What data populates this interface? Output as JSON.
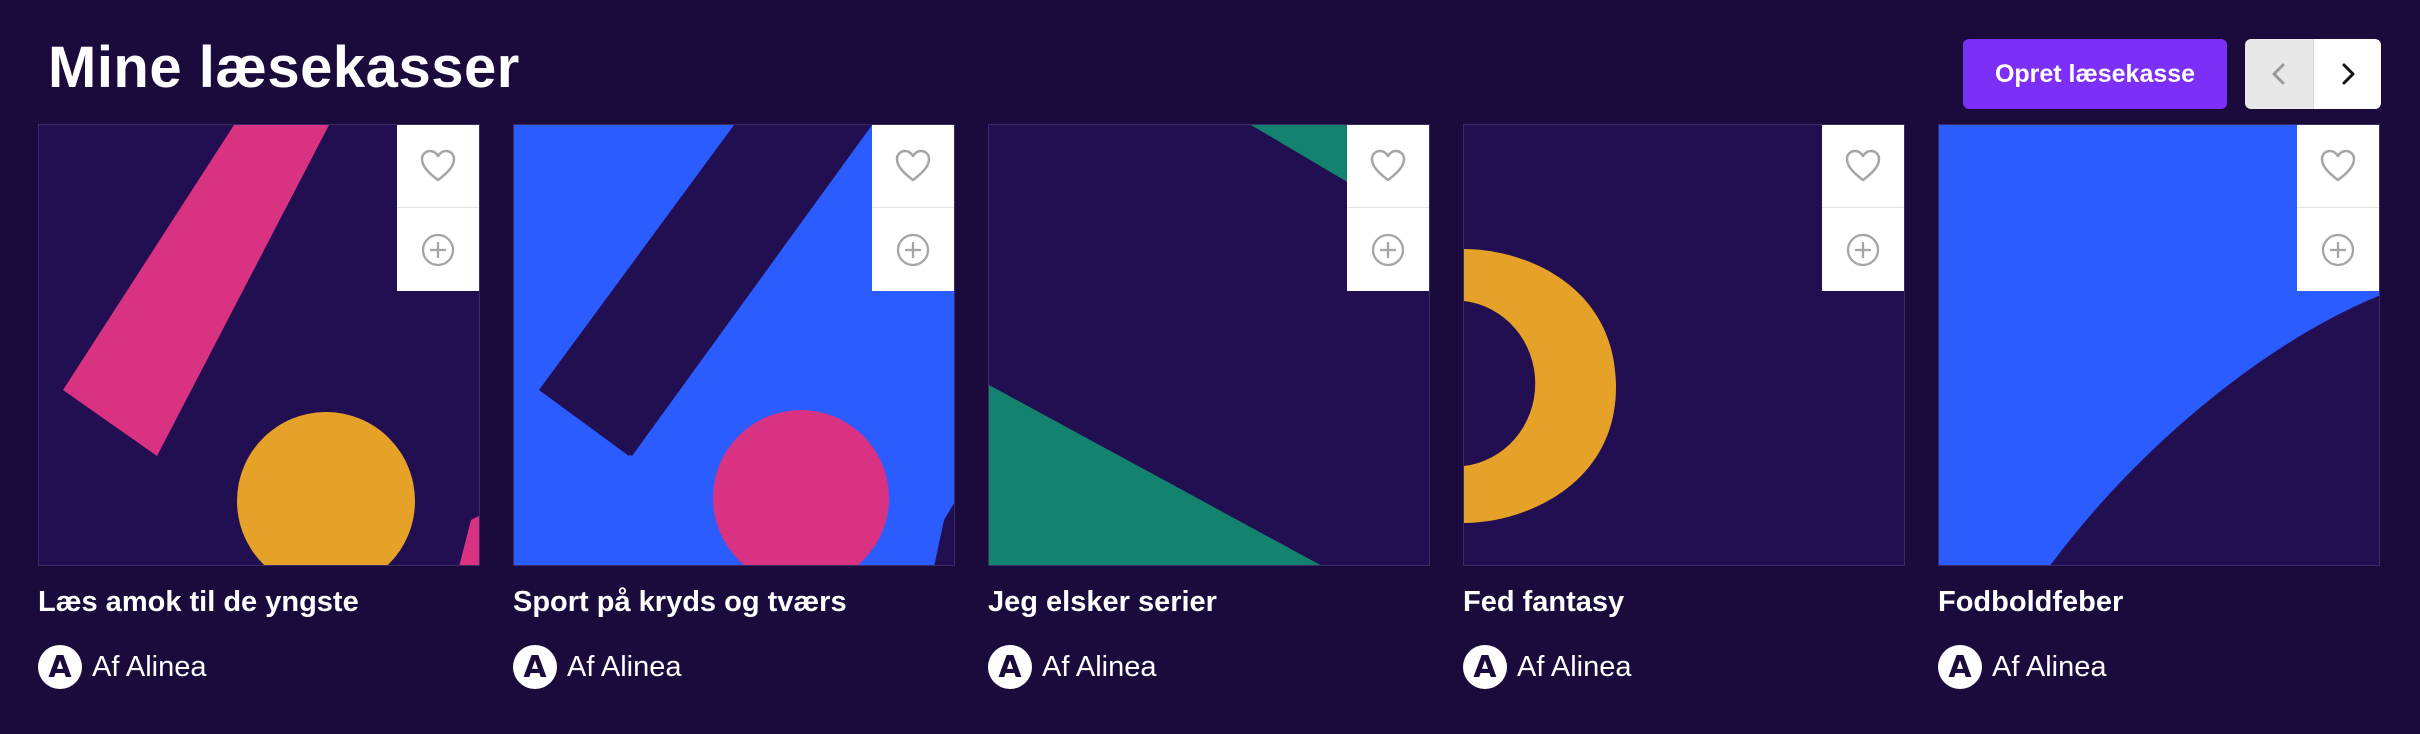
{
  "header": {
    "title": "Mine læsekasser",
    "create_label": "Opret læsekasse"
  },
  "icons": {
    "prev": "chevron-left-icon",
    "next": "chevron-right-icon",
    "favorite": "heart-icon",
    "add": "plus-circle-icon"
  },
  "colors": {
    "background": "#1b0b3d",
    "accent": "#7b2ff7",
    "card_dark": "#220f52",
    "pink": "#d93282",
    "yellow": "#e6a228",
    "blue": "#2a5cff",
    "green": "#13826e"
  },
  "cards": [
    {
      "title": "Læs amok til de yngste",
      "author_initial": "A",
      "author": "Af Alinea"
    },
    {
      "title": "Sport på kryds og tværs",
      "author_initial": "A",
      "author": "Af Alinea"
    },
    {
      "title": "Jeg elsker serier",
      "author_initial": "A",
      "author": "Af Alinea"
    },
    {
      "title": "Fed fantasy",
      "author_initial": "A",
      "author": "Af Alinea"
    },
    {
      "title": "Fodboldfeber",
      "author_initial": "A",
      "author": "Af Alinea"
    }
  ]
}
